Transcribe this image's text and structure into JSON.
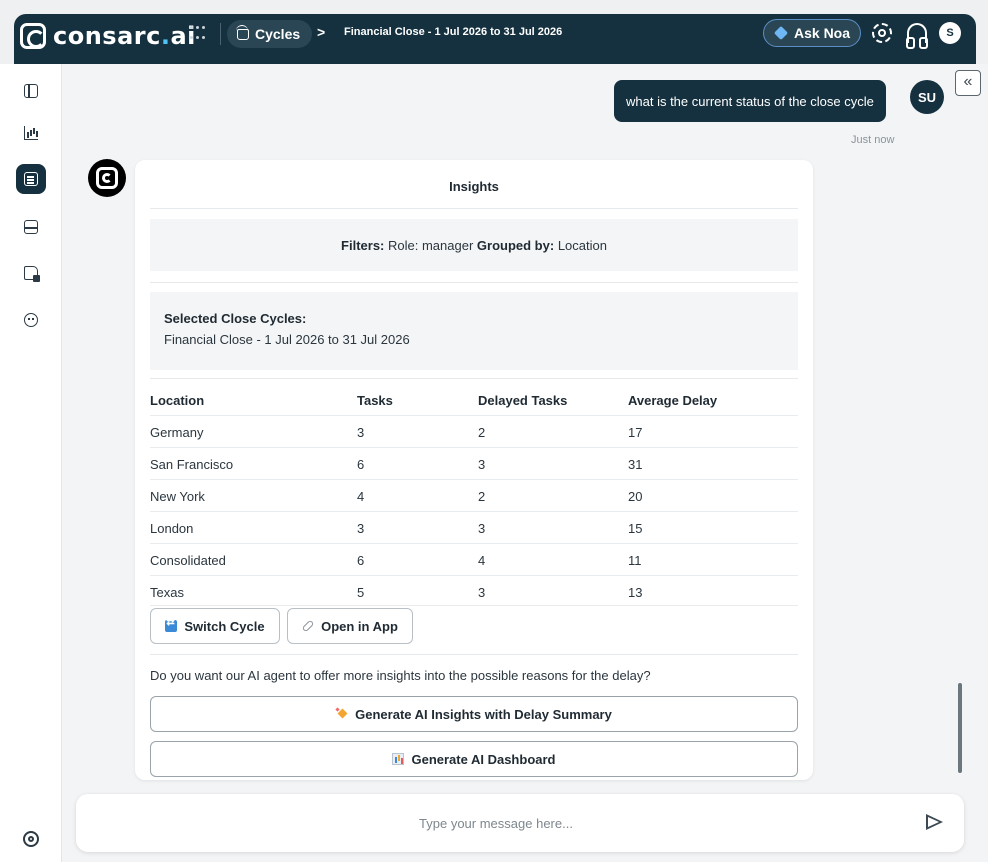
{
  "app": {
    "logo_text_main": "consarc",
    "logo_text_dot": ".",
    "logo_text_suffix": "ai"
  },
  "topbar": {
    "breadcrumb_root": "Cycles",
    "breadcrumb_separator": ">",
    "breadcrumb_current": "Financial Close - 1 Jul 2026 to 31 Jul 2026",
    "ask_noa_label": "Ask Noa",
    "user_initial": "S"
  },
  "sidebar": {
    "items": [
      {
        "icon": "panel-toggle-icon"
      },
      {
        "icon": "chart-icon"
      },
      {
        "icon": "notes-icon",
        "active": true
      },
      {
        "icon": "inbox-icon"
      },
      {
        "icon": "file-lock-icon"
      },
      {
        "icon": "bot-icon"
      }
    ],
    "footer_icon": "target-icon"
  },
  "chat": {
    "user_message": "what is the current status of the close cycle",
    "user_avatar": "SU",
    "timestamp": "Just now",
    "collapse_label": "«"
  },
  "insights": {
    "title": "Insights",
    "filters_label": "Filters:",
    "filters_value": "Role: manager",
    "grouped_label": "Grouped by:",
    "grouped_value": "Location",
    "selected_label": "Selected Close Cycles:",
    "selected_value": "Financial Close - 1 Jul 2026 to 31 Jul 2026",
    "columns": [
      "Location",
      "Tasks",
      "Delayed Tasks",
      "Average Delay"
    ],
    "rows": [
      [
        "Germany",
        "3",
        "2",
        "17"
      ],
      [
        "San Francisco",
        "6",
        "3",
        "31"
      ],
      [
        "New York",
        "4",
        "2",
        "20"
      ],
      [
        "London",
        "3",
        "3",
        "15"
      ],
      [
        "Consolidated",
        "6",
        "4",
        "11"
      ],
      [
        "Texas",
        "5",
        "3",
        "13"
      ]
    ],
    "switch_cycle_label": "Switch Cycle",
    "open_in_app_label": "Open in App",
    "question": "Do you want our AI agent to offer more insights into the possible reasons for the delay?",
    "generate_insights_label": "Generate AI Insights with Delay Summary",
    "generate_dashboard_label": "Generate AI Dashboard"
  },
  "composer": {
    "placeholder": "Type your message here..."
  },
  "colors": {
    "brand_dark": "#15313f",
    "accent_blue": "#3b8ad8",
    "background": "#f3f4f5"
  }
}
